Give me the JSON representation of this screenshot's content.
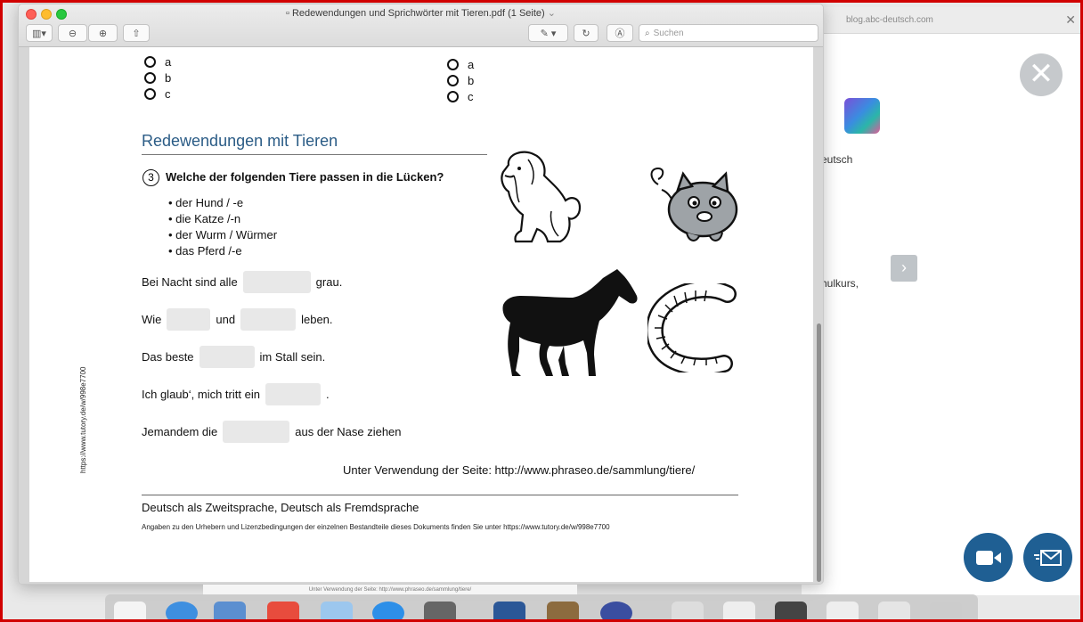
{
  "window": {
    "title": "Redewendungen und Sprichwörter mit Tieren.pdf (1 Seite)",
    "search_placeholder": "Suchen"
  },
  "background_browser": {
    "url": "blog.abc-deutsch.com",
    "text_fragment_1": "eutsch",
    "text_fragment_2": "hulkurs,"
  },
  "page": {
    "options_left": [
      "a",
      "b",
      "c"
    ],
    "options_right": [
      "a",
      "b",
      "c"
    ],
    "section_title": "Redewendungen mit Tieren",
    "task_number": "3",
    "task_question": "Welche der folgenden Tiere passen in die Lücken?",
    "word_list": [
      "der Hund / -e",
      "die Katze /-n",
      "der Wurm / Würmer",
      "das Pferd /-e"
    ],
    "sentences": [
      {
        "before": "Bei Nacht sind alle",
        "after": "grau."
      },
      {
        "before": "Wie",
        "middle": "und",
        "after": "leben."
      },
      {
        "before": "Das beste",
        "after": "im Stall sein."
      },
      {
        "before": "Ich glaub‘, mich tritt ein",
        "after": "."
      },
      {
        "before": "Jemandem die",
        "after": "aus der Nase ziehen"
      }
    ],
    "source": "Unter Verwendung der Seite: http://www.phraseo.de/sammlung/tiere/",
    "footer_title": "Deutsch als Zweitsprache, Deutsch als Fremdsprache",
    "footer_small": "Angaben zu den Urhebern und Lizenzbedingungen der einzelnen Bestandteile dieses Dokuments finden Sie unter https://www.tutory.de/w/998e7700",
    "side_url": "https://www.tutory.de/w/998e7700",
    "bottom_strip_text": "Unter Verwendung der Seite: http://www.phraseo.de/sammlung/tiere/"
  },
  "icons": {
    "overlay_close": "close-icon",
    "video": "video-camera-icon",
    "mail": "mail-send-icon"
  },
  "colors": {
    "accent_title": "#2b5c86",
    "round_buttons": "#1f5f93",
    "frame": "#d10000"
  }
}
